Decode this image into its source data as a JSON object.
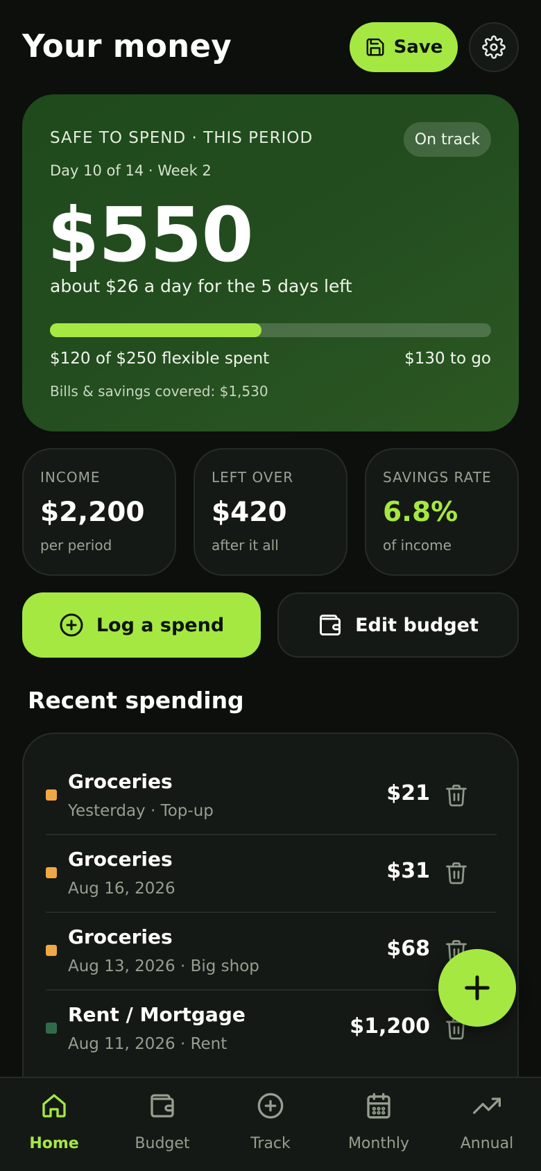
{
  "header": {
    "title": "Your money",
    "save_label": "Save"
  },
  "hero": {
    "label": "SAFE TO SPEND · THIS PERIOD",
    "badge": "On track",
    "day_info": "Day 10 of 14 · Week 2",
    "amount": "$550",
    "subtitle": "about $26 a day for the 5 days left",
    "progress_fraction": 0.48,
    "spent_text": "$120 of $250 flexible spent",
    "to_go_text": "$130 to go",
    "bills_text": "Bills & savings covered: $1,530"
  },
  "stats": [
    {
      "label": "INCOME",
      "value": "$2,200",
      "sub": "per period",
      "color": "#ffffff"
    },
    {
      "label": "LEFT OVER",
      "value": "$420",
      "sub": "after it all",
      "color": "#ffffff"
    },
    {
      "label": "SAVINGS RATE",
      "value": "6.8%",
      "sub": "of income",
      "color": "#a6e842"
    }
  ],
  "actions": {
    "log_label": "Log a spend",
    "edit_label": "Edit budget"
  },
  "recent": {
    "title": "Recent spending",
    "items": [
      {
        "title": "Groceries",
        "meta": "Yesterday · Top-up",
        "amount": "$21",
        "color": "#f0a845"
      },
      {
        "title": "Groceries",
        "meta": "Aug 16, 2026",
        "amount": "$31",
        "color": "#f0a845"
      },
      {
        "title": "Groceries",
        "meta": "Aug 13, 2026 · Big shop",
        "amount": "$68",
        "color": "#f0a845"
      },
      {
        "title": "Rent / Mortgage",
        "meta": "Aug 11, 2026 · Rent",
        "amount": "$1,200",
        "color": "#2f6b4a"
      }
    ]
  },
  "nav": {
    "items": [
      {
        "label": "Home",
        "icon": "home-icon",
        "active": true
      },
      {
        "label": "Budget",
        "icon": "wallet-icon",
        "active": false
      },
      {
        "label": "Track",
        "icon": "plus-circle-icon",
        "active": false
      },
      {
        "label": "Monthly",
        "icon": "calendar-icon",
        "active": false
      },
      {
        "label": "Annual",
        "icon": "trending-up-icon",
        "active": false
      }
    ]
  },
  "colors": {
    "accent": "#a6e842",
    "background": "#0c0f0c",
    "card": "#151915",
    "hero": "#234d1f",
    "groceries": "#f0a845",
    "housing": "#2f6b4a"
  }
}
